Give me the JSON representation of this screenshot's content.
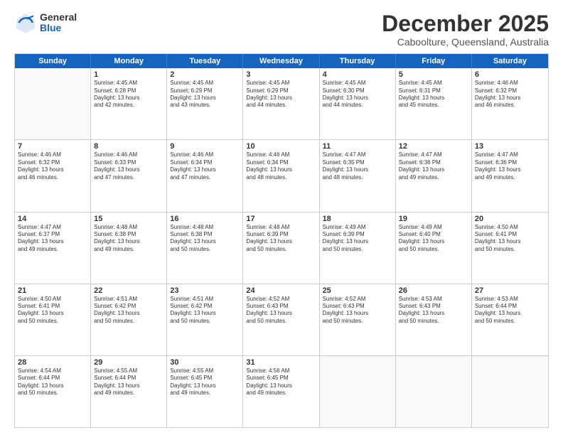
{
  "header": {
    "logo_general": "General",
    "logo_blue": "Blue",
    "month_title": "December 2025",
    "subtitle": "Caboolture, Queensland, Australia"
  },
  "days_of_week": [
    "Sunday",
    "Monday",
    "Tuesday",
    "Wednesday",
    "Thursday",
    "Friday",
    "Saturday"
  ],
  "weeks": [
    [
      {
        "day": "",
        "lines": []
      },
      {
        "day": "1",
        "lines": [
          "Sunrise: 4:45 AM",
          "Sunset: 6:28 PM",
          "Daylight: 13 hours",
          "and 42 minutes."
        ]
      },
      {
        "day": "2",
        "lines": [
          "Sunrise: 4:45 AM",
          "Sunset: 6:29 PM",
          "Daylight: 13 hours",
          "and 43 minutes."
        ]
      },
      {
        "day": "3",
        "lines": [
          "Sunrise: 4:45 AM",
          "Sunset: 6:29 PM",
          "Daylight: 13 hours",
          "and 44 minutes."
        ]
      },
      {
        "day": "4",
        "lines": [
          "Sunrise: 4:45 AM",
          "Sunset: 6:30 PM",
          "Daylight: 13 hours",
          "and 44 minutes."
        ]
      },
      {
        "day": "5",
        "lines": [
          "Sunrise: 4:45 AM",
          "Sunset: 6:31 PM",
          "Daylight: 13 hours",
          "and 45 minutes."
        ]
      },
      {
        "day": "6",
        "lines": [
          "Sunrise: 4:46 AM",
          "Sunset: 6:32 PM",
          "Daylight: 13 hours",
          "and 46 minutes."
        ]
      }
    ],
    [
      {
        "day": "7",
        "lines": [
          "Sunrise: 4:46 AM",
          "Sunset: 6:32 PM",
          "Daylight: 13 hours",
          "and 46 minutes."
        ]
      },
      {
        "day": "8",
        "lines": [
          "Sunrise: 4:46 AM",
          "Sunset: 6:33 PM",
          "Daylight: 13 hours",
          "and 47 minutes."
        ]
      },
      {
        "day": "9",
        "lines": [
          "Sunrise: 4:46 AM",
          "Sunset: 6:34 PM",
          "Daylight: 13 hours",
          "and 47 minutes."
        ]
      },
      {
        "day": "10",
        "lines": [
          "Sunrise: 4:46 AM",
          "Sunset: 6:34 PM",
          "Daylight: 13 hours",
          "and 48 minutes."
        ]
      },
      {
        "day": "11",
        "lines": [
          "Sunrise: 4:47 AM",
          "Sunset: 6:35 PM",
          "Daylight: 13 hours",
          "and 48 minutes."
        ]
      },
      {
        "day": "12",
        "lines": [
          "Sunrise: 4:47 AM",
          "Sunset: 6:36 PM",
          "Daylight: 13 hours",
          "and 49 minutes."
        ]
      },
      {
        "day": "13",
        "lines": [
          "Sunrise: 4:47 AM",
          "Sunset: 6:36 PM",
          "Daylight: 13 hours",
          "and 49 minutes."
        ]
      }
    ],
    [
      {
        "day": "14",
        "lines": [
          "Sunrise: 4:47 AM",
          "Sunset: 6:37 PM",
          "Daylight: 13 hours",
          "and 49 minutes."
        ]
      },
      {
        "day": "15",
        "lines": [
          "Sunrise: 4:48 AM",
          "Sunset: 6:38 PM",
          "Daylight: 13 hours",
          "and 49 minutes."
        ]
      },
      {
        "day": "16",
        "lines": [
          "Sunrise: 4:48 AM",
          "Sunset: 6:38 PM",
          "Daylight: 13 hours",
          "and 50 minutes."
        ]
      },
      {
        "day": "17",
        "lines": [
          "Sunrise: 4:48 AM",
          "Sunset: 6:39 PM",
          "Daylight: 13 hours",
          "and 50 minutes."
        ]
      },
      {
        "day": "18",
        "lines": [
          "Sunrise: 4:49 AM",
          "Sunset: 6:39 PM",
          "Daylight: 13 hours",
          "and 50 minutes."
        ]
      },
      {
        "day": "19",
        "lines": [
          "Sunrise: 4:49 AM",
          "Sunset: 6:40 PM",
          "Daylight: 13 hours",
          "and 50 minutes."
        ]
      },
      {
        "day": "20",
        "lines": [
          "Sunrise: 4:50 AM",
          "Sunset: 6:41 PM",
          "Daylight: 13 hours",
          "and 50 minutes."
        ]
      }
    ],
    [
      {
        "day": "21",
        "lines": [
          "Sunrise: 4:50 AM",
          "Sunset: 6:41 PM",
          "Daylight: 13 hours",
          "and 50 minutes."
        ]
      },
      {
        "day": "22",
        "lines": [
          "Sunrise: 4:51 AM",
          "Sunset: 6:42 PM",
          "Daylight: 13 hours",
          "and 50 minutes."
        ]
      },
      {
        "day": "23",
        "lines": [
          "Sunrise: 4:51 AM",
          "Sunset: 6:42 PM",
          "Daylight: 13 hours",
          "and 50 minutes."
        ]
      },
      {
        "day": "24",
        "lines": [
          "Sunrise: 4:52 AM",
          "Sunset: 6:43 PM",
          "Daylight: 13 hours",
          "and 50 minutes."
        ]
      },
      {
        "day": "25",
        "lines": [
          "Sunrise: 4:52 AM",
          "Sunset: 6:43 PM",
          "Daylight: 13 hours",
          "and 50 minutes."
        ]
      },
      {
        "day": "26",
        "lines": [
          "Sunrise: 4:53 AM",
          "Sunset: 6:43 PM",
          "Daylight: 13 hours",
          "and 50 minutes."
        ]
      },
      {
        "day": "27",
        "lines": [
          "Sunrise: 4:53 AM",
          "Sunset: 6:44 PM",
          "Daylight: 13 hours",
          "and 50 minutes."
        ]
      }
    ],
    [
      {
        "day": "28",
        "lines": [
          "Sunrise: 4:54 AM",
          "Sunset: 6:44 PM",
          "Daylight: 13 hours",
          "and 50 minutes."
        ]
      },
      {
        "day": "29",
        "lines": [
          "Sunrise: 4:55 AM",
          "Sunset: 6:44 PM",
          "Daylight: 13 hours",
          "and 49 minutes."
        ]
      },
      {
        "day": "30",
        "lines": [
          "Sunrise: 4:55 AM",
          "Sunset: 6:45 PM",
          "Daylight: 13 hours",
          "and 49 minutes."
        ]
      },
      {
        "day": "31",
        "lines": [
          "Sunrise: 4:56 AM",
          "Sunset: 6:45 PM",
          "Daylight: 13 hours",
          "and 49 minutes."
        ]
      },
      {
        "day": "",
        "lines": []
      },
      {
        "day": "",
        "lines": []
      },
      {
        "day": "",
        "lines": []
      }
    ]
  ]
}
